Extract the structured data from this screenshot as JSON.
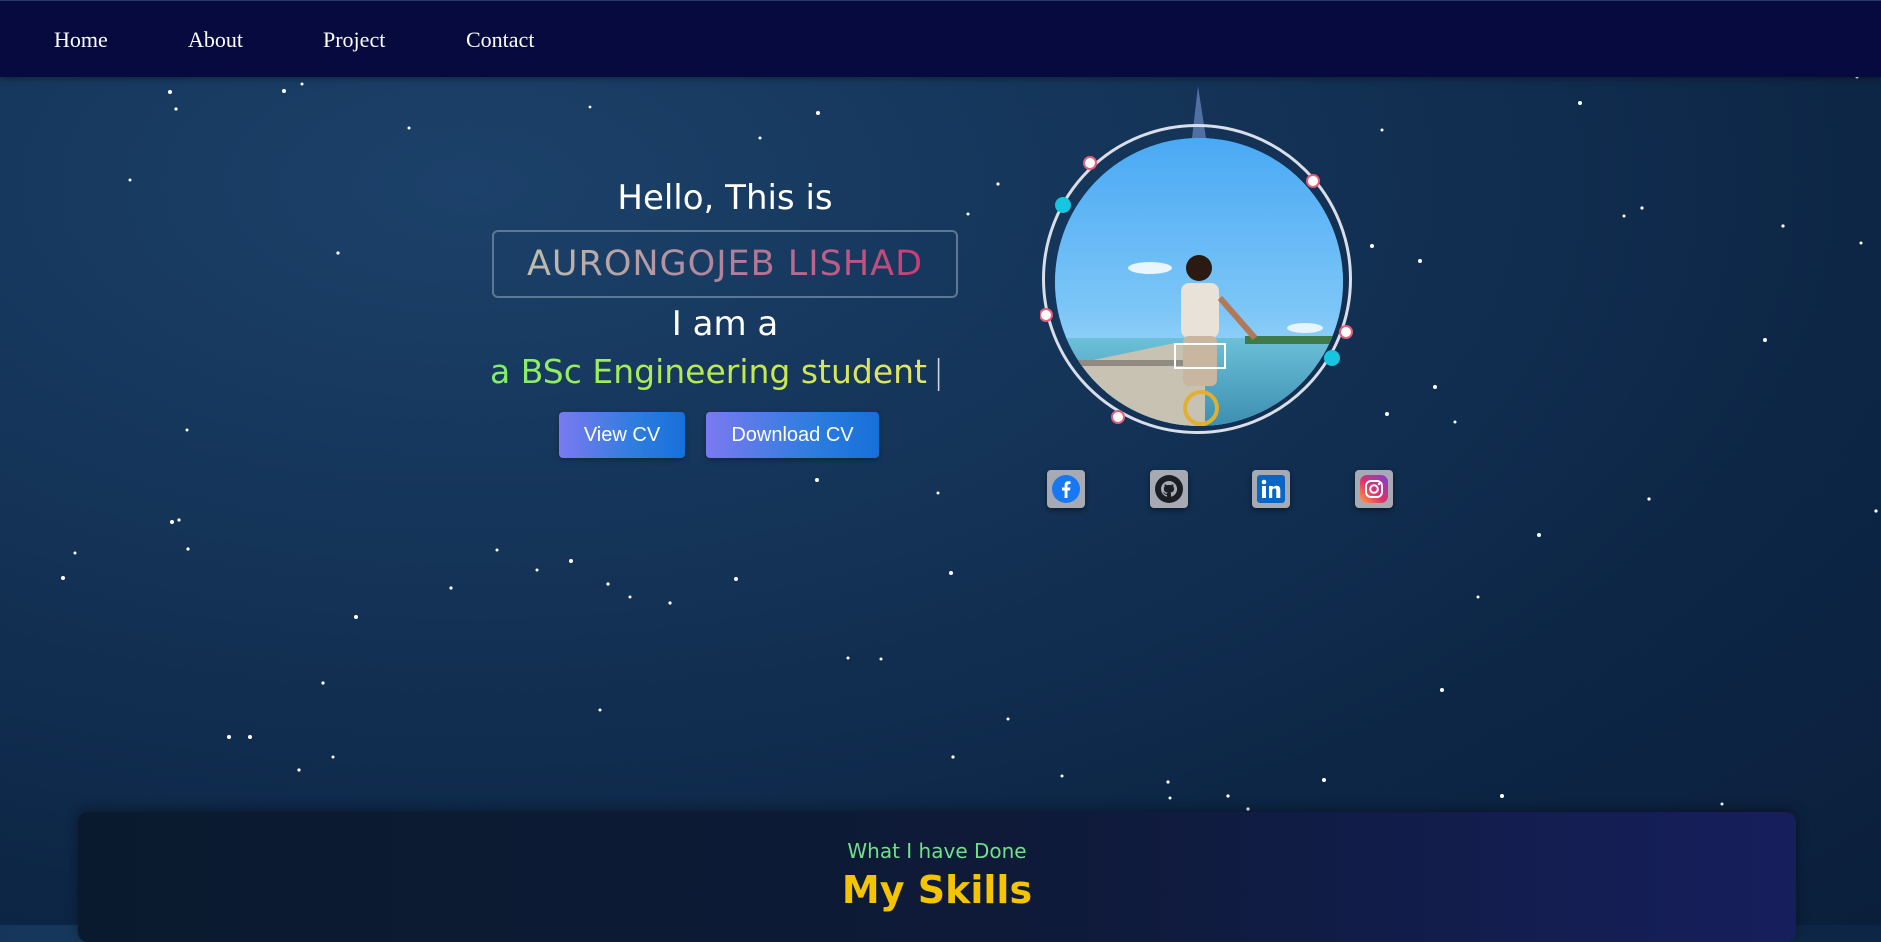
{
  "nav": {
    "items": [
      {
        "label": "Home"
      },
      {
        "label": "About"
      },
      {
        "label": "Project"
      },
      {
        "label": "Contact"
      }
    ]
  },
  "hero": {
    "greeting": "Hello, This is",
    "name": "AURONGOJEB LISHAD",
    "iam": "I am a",
    "role": "a BSc Engineering student",
    "cursor": "|",
    "view_cv": "View CV",
    "download_cv": "Download CV"
  },
  "social": [
    {
      "icon": "facebook-icon",
      "color": "#1877f2"
    },
    {
      "icon": "github-icon",
      "color": "#1b1f23"
    },
    {
      "icon": "linkedin-icon",
      "color": "#0a66c2"
    },
    {
      "icon": "instagram-icon",
      "color": "#e1306c"
    }
  ],
  "skills": {
    "subtitle": "What I have Done",
    "title": "My Skills"
  },
  "colors": {
    "nav_bg": "#060a3f",
    "accent_yellow": "#f5c400",
    "accent_green": "#70e08a",
    "button": "#1670d9"
  }
}
